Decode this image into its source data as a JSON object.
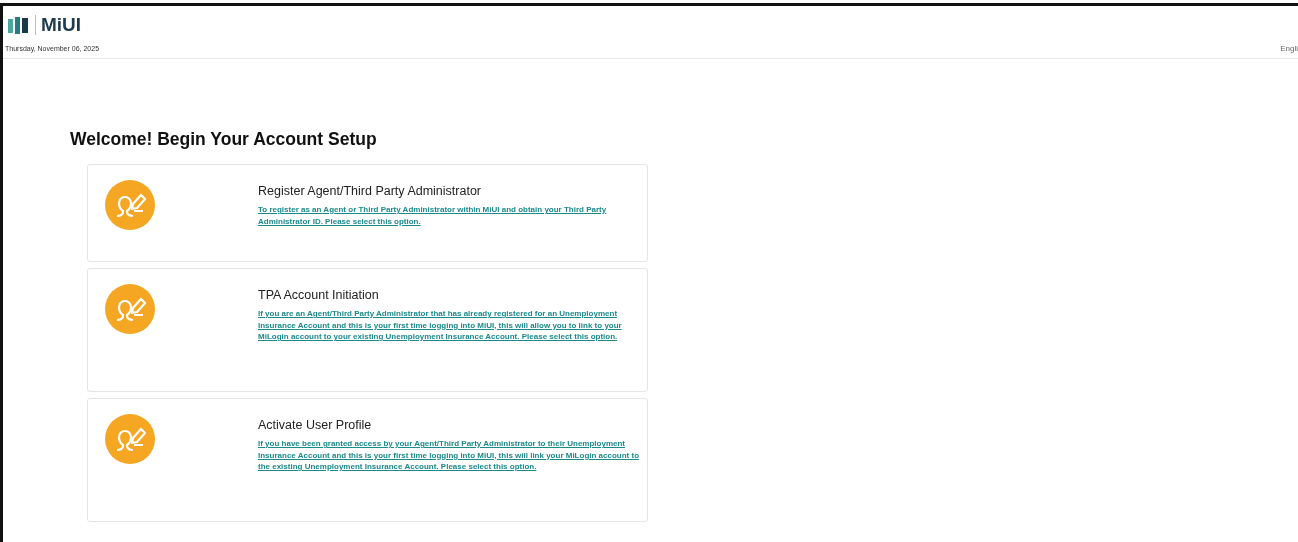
{
  "header": {
    "logo": "MiUI",
    "date": "Thursday, November 06, 2025",
    "language": "Engli"
  },
  "page_title": "Welcome! Begin Your Account Setup",
  "options": [
    {
      "title": "Register Agent/Third Party Administrator",
      "description": "To register as an Agent or Third Party Administrator within MiUI and obtain your Third Party Administrator ID. Please select this option."
    },
    {
      "title": "TPA Account Initiation",
      "description": "If you are an Agent/Third Party Administrator that has already registered for an Unemployment Insurance Account and this is your first time logging into MiUI, this will allow you to link to your MiLogin account to your existing Unemployment Insurance Account. Please select this option."
    },
    {
      "title": "Activate User Profile",
      "description": "If you have been granted access by your Agent/Third Party Administrator to their Unemployment Insurance Account and this is your first time logging into MiUI, this will link your MiLogin account to the existing Unemployment Insurance Account. Please select this option."
    }
  ]
}
